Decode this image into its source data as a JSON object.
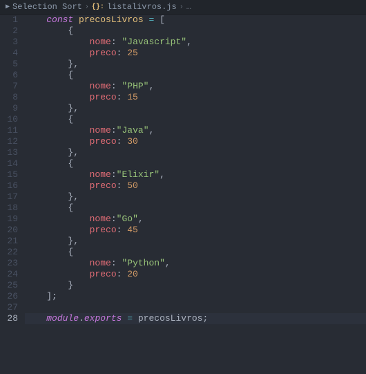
{
  "breadcrumb": {
    "folder": "Selection Sort",
    "file": "listalivros.js",
    "more": "…"
  },
  "gutter": {
    "lines": [
      "1",
      "2",
      "3",
      "4",
      "5",
      "6",
      "7",
      "8",
      "9",
      "10",
      "11",
      "12",
      "13",
      "14",
      "15",
      "16",
      "17",
      "18",
      "19",
      "20",
      "21",
      "22",
      "23",
      "24",
      "25",
      "26",
      "27",
      "28"
    ],
    "activeLine": "28"
  },
  "code": {
    "l1_kw": "const ",
    "l1_name": "precosLivros",
    "l1_eq": " = ",
    "l1_br": "[",
    "obj_open": "{",
    "obj_close": "}",
    "obj_close_comma": "},",
    "prop_nome": "nome",
    "prop_preco": "preco",
    "colon_sp": ": ",
    "colon": ":",
    "comma": ",",
    "q": "\"",
    "v1_nome": "Javascript",
    "v1_preco": "25",
    "v2_nome": "PHP",
    "v2_preco": "15",
    "v3_nome": "Java",
    "v3_preco": "30",
    "v4_nome": "Elixir",
    "v4_preco": "50",
    "v5_nome": "Go",
    "v5_preco": "45",
    "v6_nome": "Python",
    "v6_preco": "20",
    "close_arr": "];",
    "l28_module": "module",
    "l28_dot": ".",
    "l28_exports": "exports",
    "l28_eq": " = ",
    "l28_var": "precosLivros",
    "l28_semi": ";",
    "ind1": "    ",
    "ind2": "        ",
    "ind3": "            ",
    "guide": "│"
  }
}
